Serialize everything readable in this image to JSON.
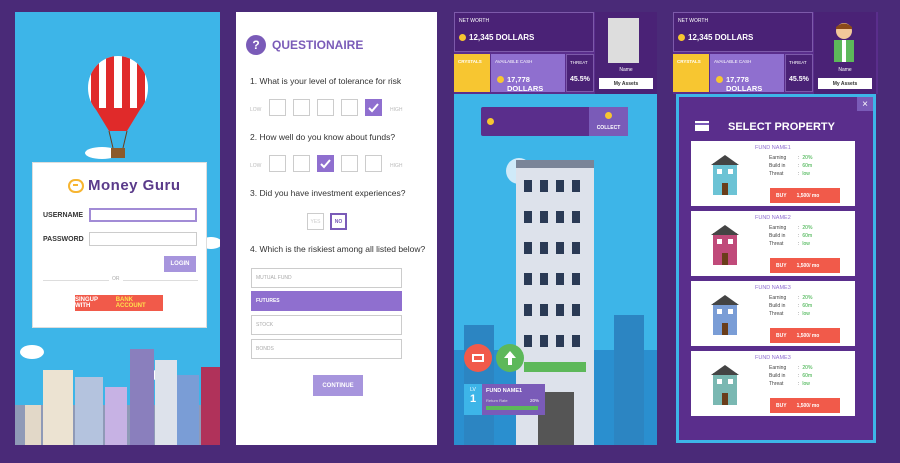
{
  "login": {
    "brand": "Money Guru",
    "username_label": "USERNAME",
    "password_label": "PASSWORD",
    "login_button": "LOGIN",
    "or_text": "OR",
    "signup_prefix": "SINGUP WITH",
    "signup_highlight": "BANK ACCOUNT"
  },
  "questionnaire": {
    "title": "QUESTIONAIRE",
    "icon": "question-icon",
    "q1": "1. What is your level of tolerance for risk",
    "q2": "2. How well do you know about funds?",
    "q3": "3. Did you have investment experiences?",
    "q4": "4. Which is the riskiest among all listed below?",
    "low": "LOW",
    "high": "HIGH",
    "yes": "YES",
    "no": "NO",
    "q1_selected": 5,
    "q2_selected": 3,
    "options": [
      "MUTUAL FUND",
      "FUTURES",
      "STOCK",
      "BONDS"
    ],
    "selected_option": "FUTURES",
    "continue_button": "CONTINUE"
  },
  "dashboard": {
    "net_worth_label": "NET WORTH",
    "net_worth_value": "12,345",
    "net_worth_unit": "DOLLARS",
    "crystals_label": "CRYSTALS",
    "available_cash_label": "AVAILABLE CASH",
    "available_cash_value": "17,778 DOLLARS",
    "threat_label": "THREAT",
    "threat_value": "45.5%",
    "profile_name": "Name",
    "my_assets": "My Assets",
    "collect_button": "COLLECT",
    "level_label": "LV",
    "level_value": "1",
    "fund_name": "FUND NAME1",
    "fund_sub": "Return Rate",
    "fund_pct": "20%",
    "accent": "#7a5bb8",
    "bg": "#3db5e8"
  },
  "property": {
    "title": "SELECT PROPERTY",
    "cards": [
      {
        "name": "FUND NAME1",
        "earning": "20%",
        "build_in": "60m",
        "threat": "low",
        "price": "1,500/ mo"
      },
      {
        "name": "FUND NAME2",
        "earning": "20%",
        "build_in": "60m",
        "threat": "low",
        "price": "1,500/ mo"
      },
      {
        "name": "FUND NAME3",
        "earning": "20%",
        "build_in": "60m",
        "threat": "low",
        "price": "1,500/ mo"
      },
      {
        "name": "FUND NAME3",
        "earning": "20%",
        "build_in": "60m",
        "threat": "low",
        "price": "1,500/ mo"
      }
    ],
    "earning_label": "Earning",
    "build_label": "Build in",
    "threat_label": "Threat",
    "buy_label": "BUY",
    "close": "×"
  }
}
